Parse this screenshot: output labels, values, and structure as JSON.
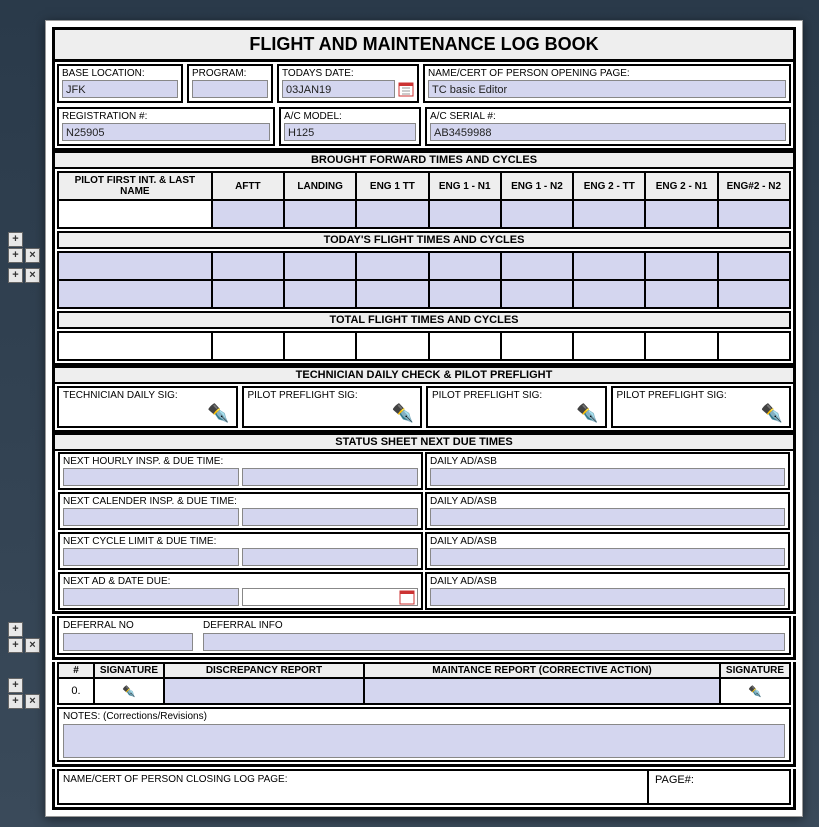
{
  "title": "FLIGHT AND MAINTENANCE LOG BOOK",
  "header": {
    "base_location_lbl": "BASE LOCATION:",
    "base_location": "JFK",
    "program_lbl": "PROGRAM:",
    "program": "",
    "todays_date_lbl": "TODAYS DATE:",
    "todays_date": "03JAN19",
    "person_opening_lbl": "NAME/CERT OF PERSON OPENING PAGE:",
    "person_opening": "TC basic Editor",
    "registration_lbl": "REGISTRATION #:",
    "registration": "N25905",
    "ac_model_lbl": "A/C MODEL:",
    "ac_model": "H125",
    "ac_serial_lbl": "A/C SERIAL #:",
    "ac_serial": "AB3459988"
  },
  "bands": {
    "bf": "BROUGHT FORWARD TIMES AND CYCLES",
    "today": "TODAY'S FLIGHT TIMES AND CYCLES",
    "total": "TOTAL FLIGHT TIMES AND CYCLES",
    "tech": "TECHNICIAN DAILY CHECK & PILOT PREFLIGHT",
    "status": "STATUS SHEET NEXT DUE TIMES"
  },
  "grid_headers": [
    "PILOT FIRST INT. & LAST NAME",
    "AFTT",
    "LANDING",
    "ENG 1 TT",
    "ENG 1 - N1",
    "ENG 1 - N2",
    "ENG 2 - TT",
    "ENG 2 - N1",
    "ENG#2 - N2"
  ],
  "sig": {
    "tech": "TECHNICIAN DAILY SIG:",
    "pilot": "PILOT PREFLIGHT SIG:"
  },
  "status": {
    "hourly": "NEXT HOURLY INSP. & DUE TIME:",
    "calendar": "NEXT CALENDER INSP. & DUE TIME:",
    "cycle": "NEXT CYCLE LIMIT & DUE TIME:",
    "ad": "NEXT AD & DATE DUE:",
    "daily": "DAILY AD/ASB"
  },
  "deferral": {
    "no_lbl": "DEFERRAL NO",
    "info_lbl": "DEFERRAL INFO"
  },
  "disc": {
    "num": "#",
    "sig": "SIGNATURE",
    "report": "DISCREPANCY REPORT",
    "maint": "MAINTANCE REPORT (CORRECTIVE ACTION)",
    "row0": "0."
  },
  "notes_lbl": "NOTES: (Corrections/Revisions)",
  "footer": {
    "closing": "NAME/CERT OF PERSON CLOSING LOG PAGE:",
    "page": "PAGE#:"
  },
  "colors": {
    "input_bg": "#d4d6ef"
  }
}
